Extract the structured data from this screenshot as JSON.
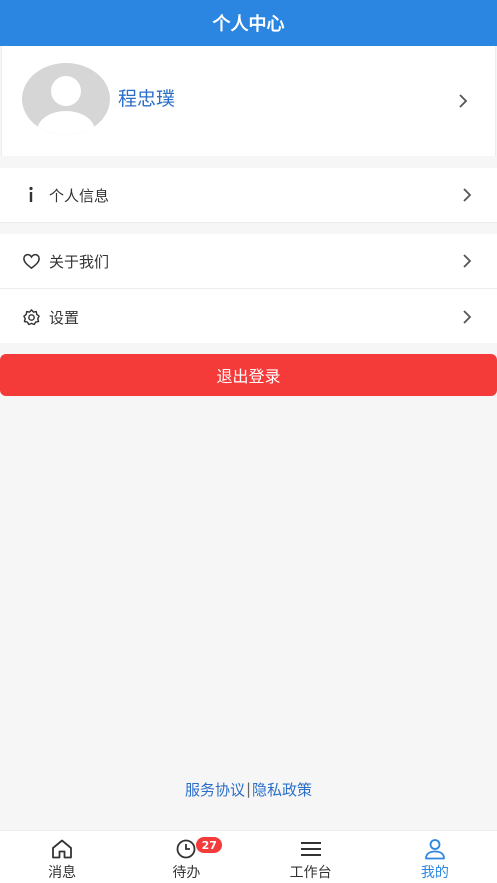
{
  "header": {
    "title": "个人中心"
  },
  "profile": {
    "name": "程忠璞"
  },
  "menu": {
    "info_label": "个人信息",
    "about_label": "关于我们",
    "settings_label": "设置"
  },
  "logout": {
    "label": "退出登录"
  },
  "footer_links": {
    "service_label": "服务协议",
    "separator": "|",
    "privacy_label": "隐私政策"
  },
  "tabbar": {
    "tabs": [
      {
        "label": "消息",
        "icon": "home-icon"
      },
      {
        "label": "待办",
        "icon": "clock-icon",
        "badge": "27"
      },
      {
        "label": "工作台",
        "icon": "menu-icon"
      },
      {
        "label": "我的",
        "icon": "user-icon",
        "active": true
      }
    ]
  },
  "colors": {
    "primary": "#2b86e2",
    "danger": "#f53a3a",
    "link": "#2b6fc9"
  }
}
